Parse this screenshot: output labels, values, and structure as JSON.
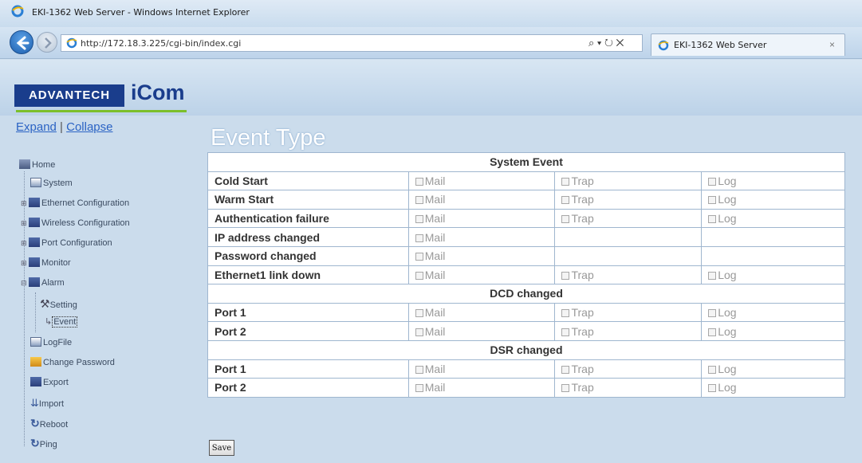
{
  "window": {
    "title": "EKI-1362 Web Server - Windows Internet Explorer"
  },
  "browser": {
    "url": "http://172.18.3.225/cgi-bin/index.cgi",
    "tools": "⌕ ▾ ↻ ✕",
    "tab_title": "EKI-1362 Web Server",
    "tab_close": "×"
  },
  "logo": {
    "brand": "ADVANTECH",
    "product": "iCom"
  },
  "sidebar": {
    "expand": "Expand",
    "collapse": "Collapse",
    "separator": "|",
    "items": [
      {
        "label": "Home"
      },
      {
        "label": "System"
      },
      {
        "label": "Ethernet Configuration"
      },
      {
        "label": "Wireless Configuration"
      },
      {
        "label": "Port Configuration"
      },
      {
        "label": "Monitor"
      },
      {
        "label": "Alarm"
      },
      {
        "label": "Setting"
      },
      {
        "label": "Event"
      },
      {
        "label": "LogFile"
      },
      {
        "label": "Change Password"
      },
      {
        "label": "Export"
      },
      {
        "label": "Import"
      },
      {
        "label": "Reboot"
      },
      {
        "label": "Ping"
      }
    ]
  },
  "main": {
    "title": "Event Type",
    "option_labels": {
      "mail": "Mail",
      "trap": "Trap",
      "log": "Log"
    },
    "sections": [
      {
        "title": "System Event",
        "rows": [
          {
            "label": "Cold Start"
          },
          {
            "label": "Warm Start"
          },
          {
            "label": "Authentication failure"
          },
          {
            "label": "IP address changed"
          },
          {
            "label": "Password changed"
          },
          {
            "label": "Ethernet1 link down"
          }
        ]
      },
      {
        "title": "DCD changed",
        "rows": [
          {
            "label": "Port 1"
          },
          {
            "label": "Port 2"
          }
        ]
      },
      {
        "title": "DSR changed",
        "rows": [
          {
            "label": "Port 1"
          },
          {
            "label": "Port 2"
          }
        ]
      }
    ],
    "save_label": "Save"
  }
}
